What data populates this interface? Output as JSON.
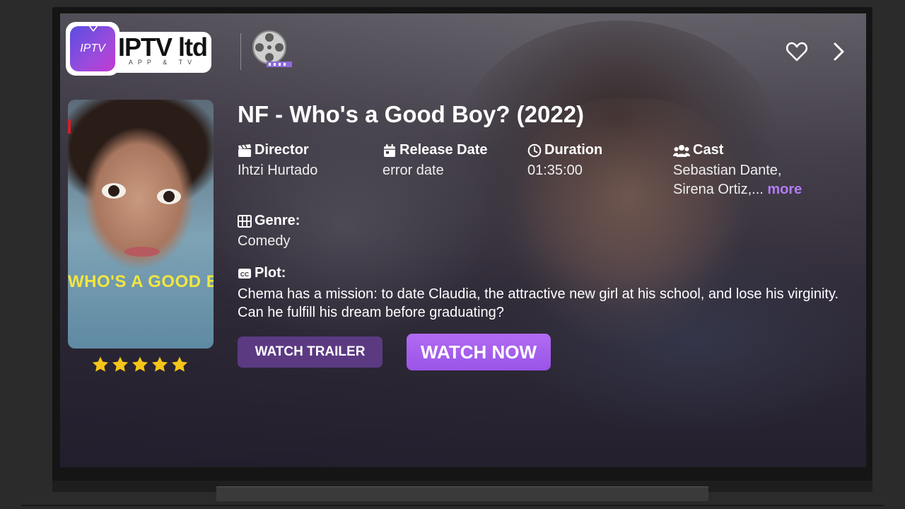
{
  "header": {
    "logo": {
      "badge_text": "IPTV",
      "badge_sub": "ltd",
      "brand": "IPTV ltd",
      "tagline": "APP & TV"
    },
    "icons": [
      "film-reel-icon",
      "heart-icon",
      "chevron-right-icon"
    ]
  },
  "movie": {
    "title": "NF - Who's a Good Boy? (2022)",
    "poster_title": "WHO'S A GOOD BOY?",
    "rating_stars": 5,
    "rating_max": 5,
    "director": {
      "label": "Director",
      "value": "Ihtzi Hurtado"
    },
    "release_date": {
      "label": "Release Date",
      "value": "error date"
    },
    "duration": {
      "label": "Duration",
      "value": "01:35:00"
    },
    "cast": {
      "label": "Cast",
      "line1": "Sebastian Dante,",
      "line2": "Sirena Ortiz,...",
      "more": "more"
    },
    "genre": {
      "label": "Genre:",
      "value": "Comedy"
    },
    "plot": {
      "label": "Plot:",
      "value": "Chema has a mission: to date Claudia, the attractive new girl at his school, and lose his virginity. Can he fulfill his dream before graduating?"
    }
  },
  "actions": {
    "trailer_label": "WATCH TRAILER",
    "watch_label": "WATCH NOW"
  },
  "colors": {
    "accent": "#a35ef0",
    "trailer_button": "#5b3a82",
    "more_link": "#b37cf5",
    "star": "#f5c518"
  }
}
